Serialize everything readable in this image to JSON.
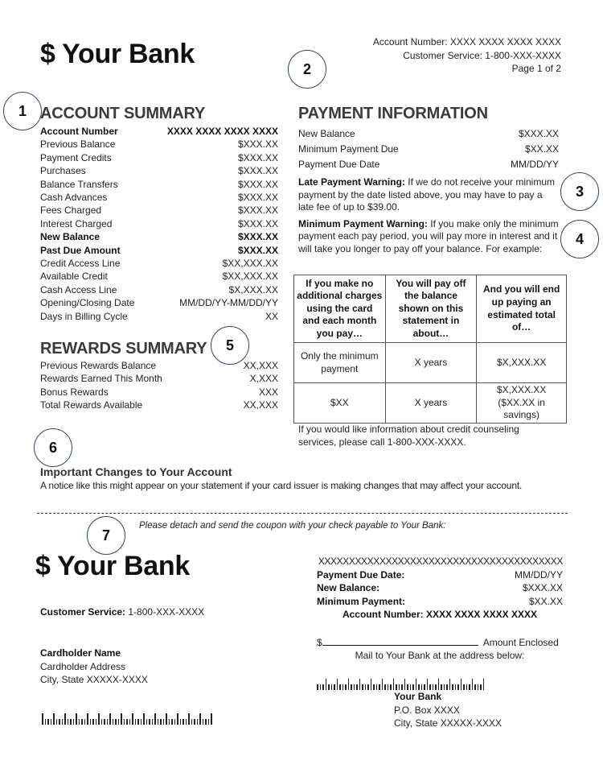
{
  "header": {
    "logo": "$ Your Bank",
    "account_number": "Account Number: XXXX XXXX XXXX XXXX",
    "customer_service": "Customer Service: 1-800-XXX-XXXX",
    "page": "Page 1 of 2"
  },
  "callouts": [
    "1",
    "2",
    "3",
    "4",
    "5",
    "6",
    "7"
  ],
  "account_summary": {
    "title": "ACCOUNT SUMMARY",
    "rows": [
      {
        "label": "Account Number",
        "value": "XXXX XXXX XXXX XXXX",
        "bold": true
      },
      {
        "label": "Previous Balance",
        "value": "$XXX.XX",
        "bold": false
      },
      {
        "label": "Payment Credits",
        "value": "$XXX.XX",
        "bold": false
      },
      {
        "label": "Purchases",
        "value": "$XXX.XX",
        "bold": false
      },
      {
        "label": "Balance Transfers",
        "value": "$XXX.XX",
        "bold": false
      },
      {
        "label": "Cash Advances",
        "value": "$XXX.XX",
        "bold": false
      },
      {
        "label": "Fees Charged",
        "value": "$XXX.XX",
        "bold": false
      },
      {
        "label": "Interest Charged",
        "value": "$XXX.XX",
        "bold": false
      },
      {
        "label": "New Balance",
        "value": "$XXX.XX",
        "bold": true
      },
      {
        "label": "Past Due Amount",
        "value": "$XXX.XX",
        "bold": true
      },
      {
        "label": "Credit Access Line",
        "value": "$XX,XXX.XX",
        "bold": false
      },
      {
        "label": "Available Credit",
        "value": "$XX,XXX.XX",
        "bold": false
      },
      {
        "label": "Cash Access Line",
        "value": "$X,XXX.XX",
        "bold": false
      },
      {
        "label": "Opening/Closing Date",
        "value": "MM/DD/YY-MM/DD/YY",
        "bold": false
      },
      {
        "label": "Days in Billing Cycle",
        "value": "XX",
        "bold": false
      }
    ]
  },
  "rewards_summary": {
    "title": "REWARDS SUMMARY",
    "rows": [
      {
        "label": "Previous Rewards Balance",
        "value": "XX,XXX"
      },
      {
        "label": "Rewards Earned This Month",
        "value": "X,XXX"
      },
      {
        "label": "Bonus Rewards",
        "value": "XXX"
      },
      {
        "label": "Total Rewards Available",
        "value": "XX,XXX"
      }
    ]
  },
  "payment_information": {
    "title": "PAYMENT INFORMATION",
    "rows": [
      {
        "label": "New Balance",
        "value": "$XXX.XX"
      },
      {
        "label": "Minimum Payment Due",
        "value": "$XX.XX"
      },
      {
        "label": "Payment Due Date",
        "value": "MM/DD/YY"
      }
    ],
    "late_warning_label": "Late Payment Warning:",
    "late_warning_text": " If we do not receive your minimum payment by the date listed above, you may have to pay a late fee of up to $39.00.",
    "min_warning_label": "Minimum Payment Warning:",
    "min_warning_text": " If you make only the minimum payment each pay period, you will pay more in interest and it will take you longer to pay off your balance. For example:",
    "table": {
      "headers": [
        "If you make no additional charges using the card and each month you pay…",
        "You will pay off the balance shown on this statement in about…",
        "And you will end up paying an estimated total of…"
      ],
      "rows": [
        [
          "Only the minimum payment",
          "X years",
          "$X,XXX.XX"
        ],
        [
          "$XX",
          "X years",
          "$X,XXX.XX ($XX.XX in savings)"
        ]
      ]
    },
    "counseling": "If you would like information about credit counseling services, please call 1-800-XXX-XXXX."
  },
  "important_changes": {
    "title": "Important Changes to Your Account",
    "text": "A notice like this might appear on your statement if your card issuer is making changes that may affect your account."
  },
  "coupon": {
    "instruction": "Please detach and send the coupon with your check payable to Your Bank:",
    "logo": "$ Your Bank",
    "customer_service_label": "Customer Service:",
    "customer_service_value": " 1-800-XXX-XXXX",
    "cardholder_name": "Cardholder Name",
    "cardholder_address": "Cardholder Address",
    "cardholder_city": "City, State XXXXX-XXXX",
    "scanline": "XXXXXXXXXXXXXXXXXXXXXXXXXXXXXXXXXXXXXXXX",
    "rows": [
      {
        "label": "Payment Due Date:",
        "value": "MM/DD/YY"
      },
      {
        "label": "New Balance:",
        "value": "$XXX.XX"
      },
      {
        "label": "Minimum Payment:",
        "value": "$XX.XX"
      }
    ],
    "account_number": "Account Number: XXXX XXXX XXXX XXXX",
    "amount_prefix": "$",
    "amount_label": "Amount Enclosed",
    "mail_to": "Mail to Your Bank at the address below:",
    "bank_name": "Your Bank",
    "bank_box": "P.O. Box XXXX",
    "bank_city": "City, State XXXXX-XXXX"
  }
}
